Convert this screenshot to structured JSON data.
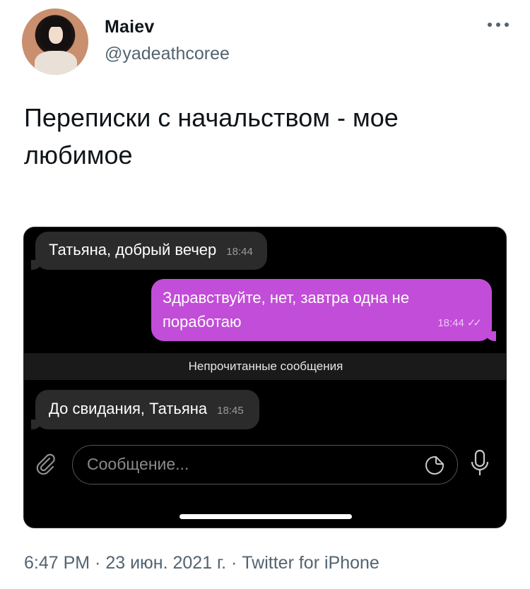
{
  "author": {
    "display_name": "Maiev",
    "handle": "@yadeathcoree"
  },
  "tweet": {
    "text": "Переписки с начальством - мое любимое",
    "meta": "6:47 PM · 23 июн. 2021 г. · Twitter for iPhone"
  },
  "chat": {
    "messages": [
      {
        "direction": "incoming",
        "text": "Татьяна, добрый вечер",
        "time": "18:44"
      },
      {
        "direction": "outgoing",
        "text": "Здравствуйте, нет, завтра одна не поработаю",
        "time": "18:44",
        "status": "read"
      },
      {
        "direction": "incoming",
        "text": "До свидания, Татьяна",
        "time": "18:45"
      }
    ],
    "unread_divider": "Непрочитанные сообщения",
    "input_placeholder": "Сообщение...",
    "colors": {
      "background": "#000000",
      "incoming_bubble": "#2b2b2b",
      "outgoing_bubble": "#c24dd8"
    }
  },
  "icons": [
    "more-icon",
    "attach-icon",
    "sticker-icon",
    "mic-icon"
  ]
}
